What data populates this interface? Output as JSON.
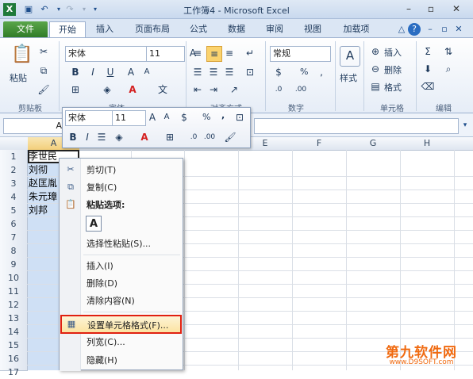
{
  "window": {
    "title": "工作簿4 - Microsoft Excel"
  },
  "tabs": [
    "文件",
    "开始",
    "插入",
    "页面布局",
    "公式",
    "数据",
    "审阅",
    "视图",
    "加载项"
  ],
  "ribbon": {
    "paste_label": "粘贴",
    "font_name": "宋体",
    "font_size": "11",
    "number_format": "常规",
    "style_label": "样式",
    "insert_label": "插入",
    "delete_label": "删除",
    "format_label": "格式",
    "groups": {
      "clipboard": "剪贴板",
      "font": "字体",
      "alignment": "对齐方式",
      "number": "数字",
      "cells": "单元格",
      "editing": "编辑"
    },
    "percent_label": "%"
  },
  "formula_bar": {
    "name_box": "A1"
  },
  "mini_toolbar": {
    "font_name": "宋体",
    "font_size": "11",
    "percent": "%",
    "comma": ","
  },
  "grid": {
    "columns": [
      "A",
      "B",
      "C",
      "D",
      "E",
      "F",
      "G",
      "H"
    ],
    "rows": [
      "1",
      "2",
      "3",
      "4",
      "5",
      "6",
      "7",
      "8",
      "9",
      "10",
      "11",
      "12",
      "13",
      "14",
      "15",
      "16",
      "17"
    ],
    "cells": [
      "李世民",
      "刘彻",
      "赵匡胤",
      "朱元璋",
      "刘邦"
    ]
  },
  "context_menu": {
    "cut": "剪切(T)",
    "copy": "复制(C)",
    "paste_options": "粘贴选项:",
    "paste_special": "选择性粘贴(S)...",
    "insert": "插入(I)",
    "delete": "删除(D)",
    "clear": "清除内容(N)",
    "format_cells": "设置单元格格式(F)...",
    "col_width": "列宽(C)...",
    "hide": "隐藏(H)"
  },
  "watermark": {
    "title": "第九软件网",
    "url": "www.D9SOFT.com"
  },
  "colors": {
    "file_tab": "#2f7a26",
    "selection": "#cfe0f5",
    "highlight_border": "#e02010",
    "watermark": "#f06a10"
  }
}
